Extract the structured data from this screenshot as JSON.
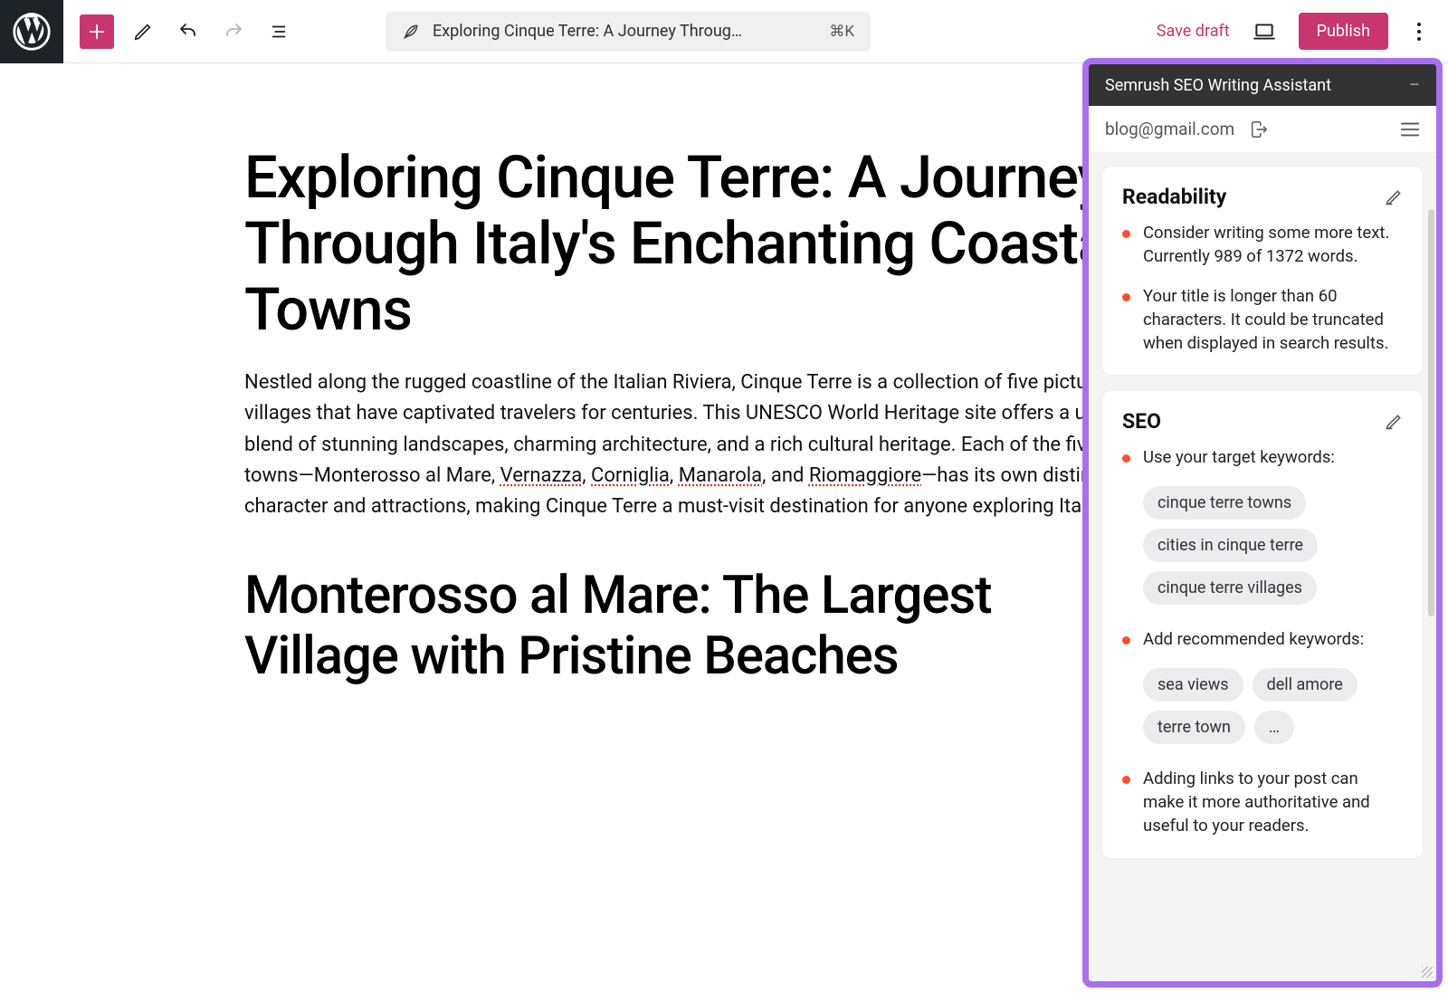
{
  "toolbar": {
    "doc_title": "Exploring Cinque Terre: A Journey Throug…",
    "kbd": "⌘K",
    "save_draft": "Save draft",
    "publish": "Publish"
  },
  "post": {
    "title": "Exploring Cinque Terre: A Journey Through Italy's Enchanting Coastal Towns",
    "para_parts": {
      "p1": "Nestled along the rugged coastline of the Italian Riviera, Cinque Terre is a collection of five picturesque villages that have captivated travelers for centuries. This UNESCO World Heritage site offers a unique blend of stunning landscapes, charming architecture, and a rich cultural heritage. Each of the five towns—Monterosso al Mare, ",
      "s1": "Vernazza",
      "c1": ", ",
      "s2": "Corniglia",
      "c2": ", ",
      "s3": "Manarola",
      "c3": ", and ",
      "s4": "Riomaggiore",
      "p2": "—has its own distinct character and attractions, making Cinque Terre a must-visit destination for anyone exploring Italy."
    },
    "h2": "Monterosso al Mare: The Largest Village with Pristine Beaches"
  },
  "panel": {
    "title": "Semrush SEO Writing Assistant",
    "account": "blog@gmail.com",
    "cards": {
      "readability": {
        "title": "Readability",
        "items": [
          "Consider writing some more text. Currently 989 of 1372 words.",
          "Your title is longer than 60 characters. It could be truncated when displayed in search results."
        ]
      },
      "seo": {
        "title": "SEO",
        "target_label": "Use your target keywords:",
        "target_kw": [
          "cinque terre towns",
          "cities in cinque terre",
          "cinque terre villages"
        ],
        "rec_label": "Add recommended keywords:",
        "rec_kw": [
          "sea views",
          "dell amore",
          "terre town",
          "…"
        ],
        "links_tip": "Adding links to your post can make it more authoritative and useful to your readers."
      }
    }
  }
}
